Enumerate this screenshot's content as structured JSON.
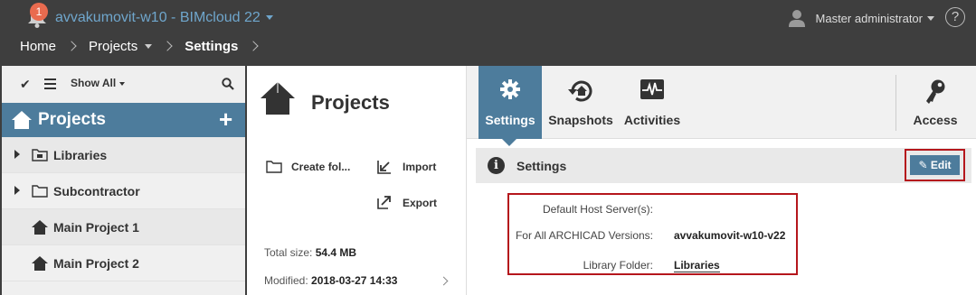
{
  "topbar": {
    "notification_count": "1",
    "server_title": "avvakumovit-w10 - BIMcloud 22",
    "user_name": "Master administrator",
    "help_label": "?"
  },
  "breadcrumb": {
    "items": [
      "Home",
      "Projects",
      "Settings"
    ]
  },
  "sidebar": {
    "show_all_label": "Show All",
    "section_title": "Projects",
    "add_label": "+",
    "items": [
      {
        "label": "Libraries",
        "icon": "library-folder-icon"
      },
      {
        "label": "Subcontractor",
        "icon": "folder-icon"
      },
      {
        "label": "Main Project 1",
        "icon": "project-icon"
      },
      {
        "label": "Main Project 2",
        "icon": "project-icon"
      }
    ]
  },
  "folder_panel": {
    "title": "Projects",
    "actions": {
      "create_folder": "Create fol...",
      "import": "Import",
      "export": "Export"
    },
    "total_size_label": "Total size:",
    "total_size_value": "54.4 MB",
    "modified_label": "Modified:",
    "modified_value": "2018-03-27 14:33"
  },
  "tabs": [
    {
      "label": "Settings",
      "icon": "gear-icon",
      "active": true
    },
    {
      "label": "Snapshots",
      "icon": "snapshot-icon",
      "active": false
    },
    {
      "label": "Activities",
      "icon": "activity-icon",
      "active": false
    },
    {
      "label": "Access",
      "icon": "key-icon",
      "active": false
    }
  ],
  "settings": {
    "section_title": "Settings",
    "edit_label": "Edit",
    "rows": [
      {
        "key": "Default Host Server(s):",
        "value": ""
      },
      {
        "key": "For All ARCHICAD Versions:",
        "value": "avvakumovit-w10-v22"
      },
      {
        "key": "Library Folder:",
        "value": "Libraries"
      }
    ]
  },
  "colors": {
    "topbar_bg": "#3e3e3e",
    "accent": "#4d7c9c",
    "highlight_frame": "#b5161c",
    "notification": "#e96b4f"
  }
}
